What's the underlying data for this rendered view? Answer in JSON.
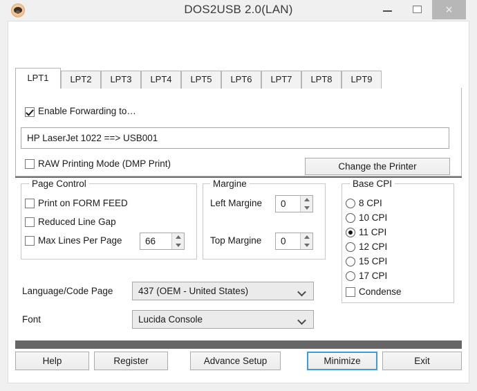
{
  "window": {
    "title": "DOS2USB 2.0(LAN)",
    "app_icon": "pug-app-icon",
    "controls": {
      "minimize": "—",
      "maximize": "□",
      "close": "×"
    }
  },
  "tabs": [
    {
      "label": "LPT1",
      "active": true
    },
    {
      "label": "LPT2",
      "active": false
    },
    {
      "label": "LPT3",
      "active": false
    },
    {
      "label": "LPT4",
      "active": false
    },
    {
      "label": "LPT5",
      "active": false
    },
    {
      "label": "LPT6",
      "active": false
    },
    {
      "label": "LPT7",
      "active": false
    },
    {
      "label": "LPT8",
      "active": false
    },
    {
      "label": "LPT9",
      "active": false
    }
  ],
  "forwarding": {
    "enable_label": "Enable Forwarding to…",
    "enable_checked": true,
    "printer_value": "HP LaserJet 1022 ==> USB001",
    "raw_mode_label": "RAW Printing Mode (DMP Print)",
    "raw_mode_checked": false,
    "change_printer_label": "Change the Printer"
  },
  "page_control": {
    "title": "Page Control",
    "print_form_feed_label": "Print on FORM FEED",
    "print_form_feed_checked": false,
    "reduced_line_gap_label": "Reduced Line Gap",
    "reduced_line_gap_checked": false,
    "max_lines_label": "Max Lines Per Page",
    "max_lines_checked": false,
    "max_lines_value": "66"
  },
  "margine": {
    "title": "Margine",
    "left_label": "Left Margine",
    "left_value": "0",
    "top_label": "Top Margine",
    "top_value": "0"
  },
  "base_cpi": {
    "title": "Base CPI",
    "options": [
      {
        "label": "8 CPI",
        "selected": false
      },
      {
        "label": "10 CPI",
        "selected": false
      },
      {
        "label": "11 CPI",
        "selected": true
      },
      {
        "label": "12 CPI",
        "selected": false
      },
      {
        "label": "15 CPI",
        "selected": false
      },
      {
        "label": "17 CPI",
        "selected": false
      }
    ],
    "condense_label": "Condense",
    "condense_checked": false
  },
  "settings": {
    "language_label": "Language/Code Page",
    "language_value": "437   (OEM - United States)",
    "font_label": "Font",
    "font_value": "Lucida Console"
  },
  "footer": {
    "buttons": [
      {
        "label": "Help",
        "focused": false
      },
      {
        "label": "Register",
        "focused": false
      },
      {
        "label": "Advance Setup",
        "focused": false
      },
      {
        "label": "Minimize",
        "focused": true
      },
      {
        "label": "Exit",
        "focused": false
      }
    ]
  },
  "colors": {
    "window_bg": "#f0f0f0",
    "client_bg": "#ffffff",
    "focus_blue": "#3e9bdd",
    "separator": "#666666",
    "close_btn_bg": "#b7b7b7"
  }
}
